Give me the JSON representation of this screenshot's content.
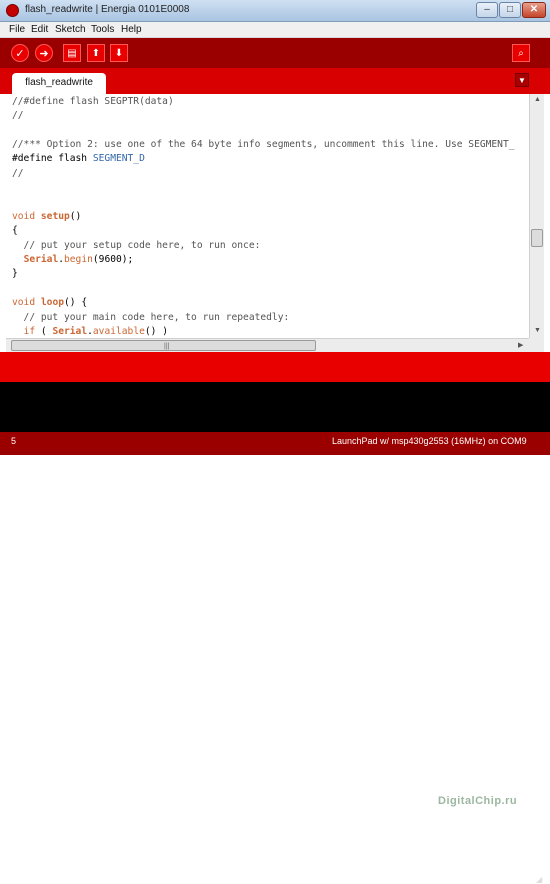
{
  "window": {
    "title": "flash_readwrite | Energia 0101E0008",
    "minimize": "–",
    "maximize": "□",
    "close": "✕"
  },
  "menu": [
    "File",
    "Edit",
    "Sketch",
    "Tools",
    "Help"
  ],
  "toolbar": {
    "verify": "✓",
    "upload": "➜",
    "new": "▤",
    "open": "⬆",
    "save": "⬇",
    "serial_monitor": "⌕"
  },
  "tabs": {
    "active": "flash_readwrite",
    "menu_arrow": "▼"
  },
  "code": {
    "line1": "//#define flash SEGPTR(data)",
    "line2": "//",
    "line3": "//*** Option 2: use one of the 64 byte info segments, uncomment this line. Use SEGMENT_",
    "line4_kw": "#define flash ",
    "line4_const": "SEGMENT_D",
    "line5": "//",
    "line6_type": "void",
    "line6_fn": "setup",
    "line6_rest": "()",
    "line7": "{",
    "line8": "  // put your setup code here, to run once:",
    "line9_cls": "Serial",
    "line9_dot": ".",
    "line9_fn": "begin",
    "line9_rest": "(9600);",
    "line10": "}",
    "line11_type": "void",
    "line11_fn": "loop",
    "line11_rest": "() {",
    "line12": "  // put your main code here, to run repeatedly:",
    "line13_if": "if",
    "line13_open": " ( ",
    "line13_cls": "Serial",
    "line13_dot": ".",
    "line13_fn": "available",
    "line13_rest": "() )"
  },
  "console": {
    "watermark": "DigitalChip.ru"
  },
  "status": {
    "line_number": "5",
    "board": "LaunchPad w/ msp430g2553 (16MHz) on COM9"
  },
  "colors": {
    "toolbar": "#9a0000",
    "tabbar": "#d80000",
    "accent": "#e80000",
    "console": "#000000"
  }
}
